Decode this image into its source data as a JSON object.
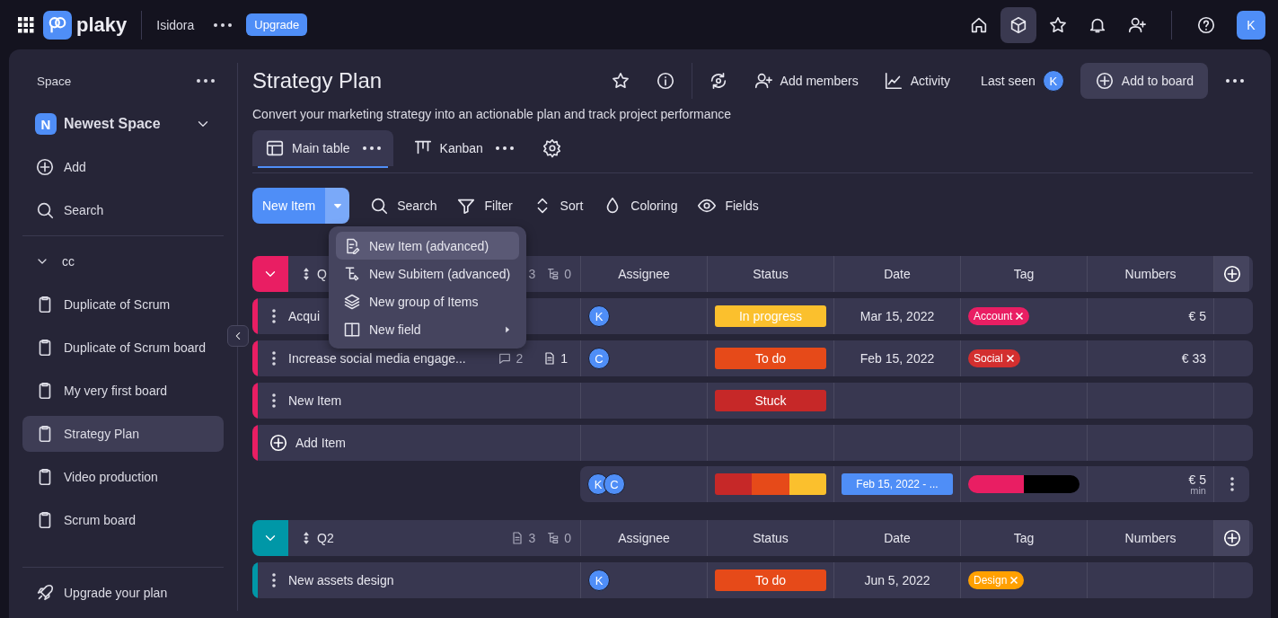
{
  "topbar": {
    "brand": "plaky",
    "workspace": "Isidora",
    "upgrade": "Upgrade",
    "nav": [
      {
        "kind": "home",
        "selected": false
      },
      {
        "kind": "cube",
        "selected": true
      },
      {
        "kind": "star",
        "selected": false
      },
      {
        "kind": "bell",
        "selected": false
      },
      {
        "kind": "invite",
        "selected": false
      }
    ],
    "avatar": "K"
  },
  "sidebar": {
    "heading": "Space",
    "space": {
      "initial": "N",
      "name": "Newest Space"
    },
    "actions": [
      {
        "kind": "add",
        "label": "Add"
      },
      {
        "kind": "search",
        "label": "Search"
      }
    ],
    "folder": {
      "name": "cc",
      "expanded": true,
      "children": [
        {
          "label": "Duplicate of Scrum",
          "selected": false
        },
        {
          "label": "Duplicate of Scrum board",
          "selected": false
        },
        {
          "label": "My very first board",
          "selected": false
        },
        {
          "label": "Strategy Plan",
          "selected": true
        },
        {
          "label": "Video production",
          "selected": false
        },
        {
          "label": "Scrum board",
          "selected": false
        }
      ]
    },
    "upgrade": "Upgrade your plan"
  },
  "board": {
    "title": "Strategy Plan",
    "description": "Convert your marketing strategy into an actionable plan and track project performance",
    "add_members": "Add members",
    "activity": "Activity",
    "last_seen": "Last seen",
    "last_seen_avatar": "K",
    "add_to_board": "Add to board",
    "views": [
      {
        "kind": "table",
        "label": "Main table",
        "selected": true
      },
      {
        "kind": "kanban",
        "label": "Kanban",
        "selected": false
      }
    ],
    "new_item": "New Item",
    "tools": [
      {
        "kind": "search",
        "label": "Search"
      },
      {
        "kind": "filter",
        "label": "Filter"
      },
      {
        "kind": "sort",
        "label": "Sort"
      },
      {
        "kind": "coloring",
        "label": "Coloring"
      },
      {
        "kind": "fields",
        "label": "Fields"
      }
    ],
    "menu": [
      {
        "kind": "item",
        "label": "New Item (advanced)",
        "selected": true,
        "submenu": false
      },
      {
        "kind": "subitem",
        "label": "New Subitem (advanced)",
        "selected": false,
        "submenu": false
      },
      {
        "kind": "group",
        "label": "New group of Items",
        "selected": false,
        "submenu": false
      },
      {
        "kind": "field",
        "label": "New field",
        "selected": false,
        "submenu": true
      }
    ],
    "groups": [
      {
        "name": "Q",
        "color": "#e91e63",
        "items_icon": false,
        "items": "3",
        "subitems": "0",
        "columns": [
          "Assignee",
          "Status",
          "Date",
          "Tag",
          "Numbers"
        ],
        "rows": [
          {
            "kind": "item",
            "name": "Acqui",
            "assignee": "K",
            "status": {
              "label": "In progress",
              "color": "#fbc02d"
            },
            "date": "Mar 15, 2022",
            "tag": {
              "label": "Account",
              "color": "#e91e63"
            },
            "number": "€ 5"
          },
          {
            "kind": "item",
            "name": "Increase social media engage...",
            "comments": "2",
            "files": "1",
            "assignee": "C",
            "status": {
              "label": "To do",
              "color": "#e64a19"
            },
            "date": "Feb 15, 2022",
            "tag": {
              "label": "Social",
              "color": "#d32f2f"
            },
            "number": "€ 33"
          },
          {
            "kind": "item",
            "name": "New Item",
            "status": {
              "label": "Stuck",
              "color": "#c62828"
            }
          },
          {
            "kind": "add",
            "name": "Add Item"
          }
        ],
        "summary": {
          "avatars": [
            "K",
            "C"
          ],
          "status_segments": [
            {
              "color": "#c62828"
            },
            {
              "color": "#e64a19"
            },
            {
              "color": "#fbc02d"
            }
          ],
          "date_range": "Feb 15, 2022 - ...",
          "tag_segments": [
            {
              "color": "#e91e63"
            },
            {
              "color": "#000000"
            }
          ],
          "number": "€ 5",
          "number_label": "min"
        }
      },
      {
        "name": "Q2",
        "color": "#0097a7",
        "items_icon": true,
        "items": "3",
        "subitems": "0",
        "columns": [
          "Assignee",
          "Status",
          "Date",
          "Tag",
          "Numbers"
        ],
        "rows": [
          {
            "kind": "item",
            "name": "New assets design",
            "assignee": "K",
            "status": {
              "label": "To do",
              "color": "#e64a19"
            },
            "date": "Jun 5, 2022",
            "tag": {
              "label": "Design",
              "color": "#ffa000"
            }
          }
        ]
      }
    ]
  }
}
